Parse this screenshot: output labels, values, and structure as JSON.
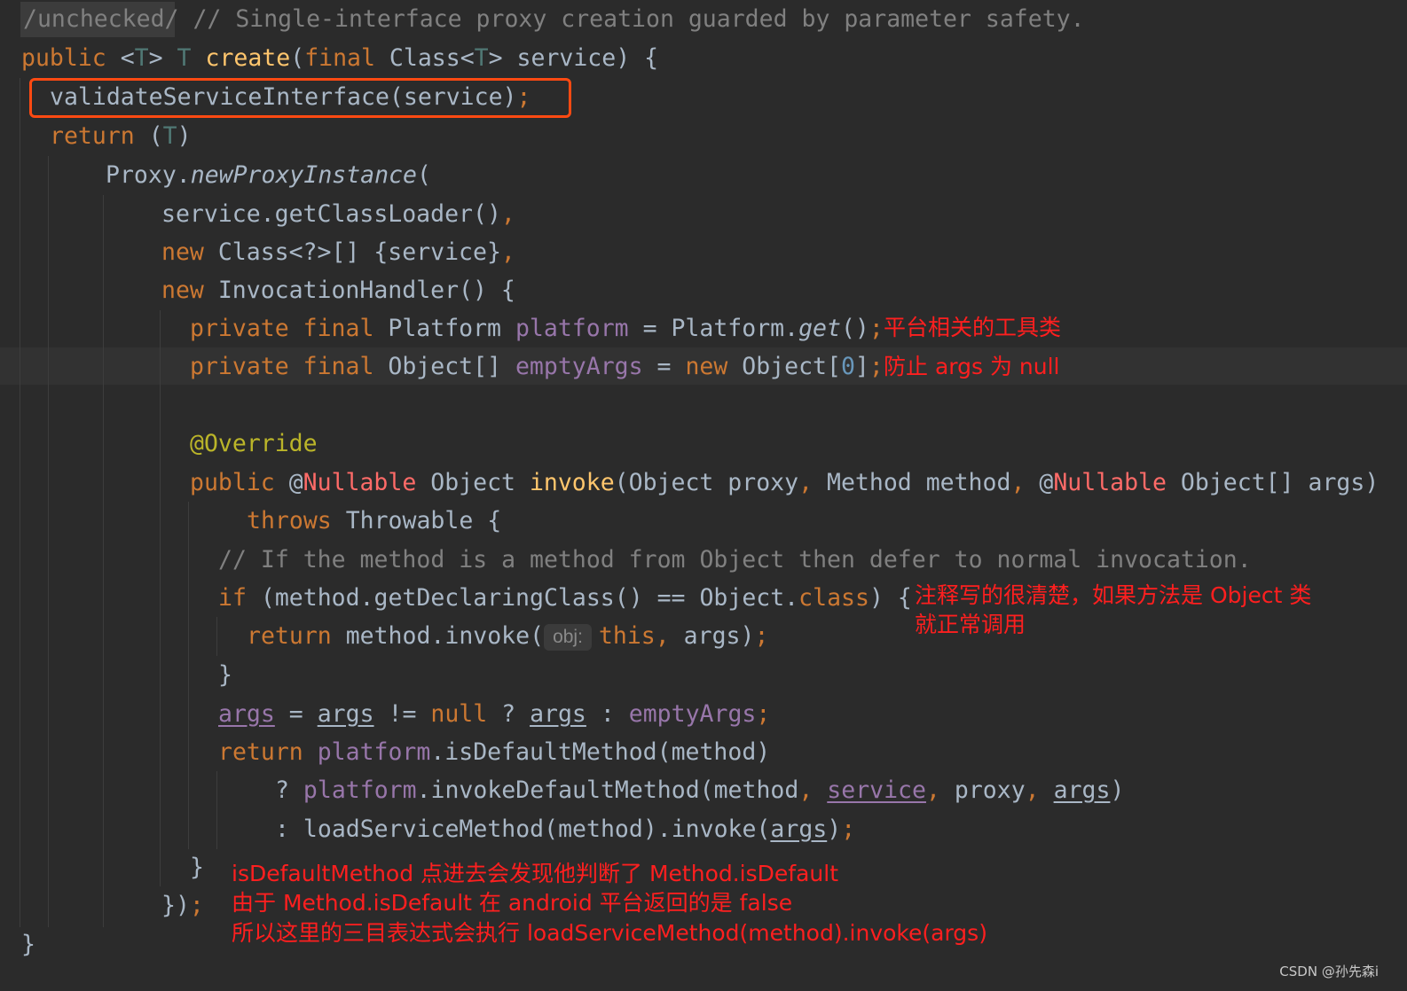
{
  "code": {
    "l1": {
      "a": "/unchecked/",
      "b": " // Single-interface proxy creation guarded by parameter safety."
    },
    "l2": {
      "a": "public",
      "b": " <",
      "c": "T",
      "d": "> ",
      "e": "T",
      "f": " ",
      "g": "create",
      "h": "(",
      "i": "final",
      "j": " Class<",
      "k": "T",
      "l": "> service) {"
    },
    "l3": {
      "a": "validateServiceInterface(service)",
      "b": ";"
    },
    "l4": {
      "a": "return",
      "b": " (",
      "c": "T",
      "d": ")"
    },
    "l5": {
      "a": "Proxy.",
      "b": "newProxyInstance",
      "c": "("
    },
    "l6": {
      "a": "service.getClassLoader()",
      "b": ","
    },
    "l7": {
      "a": "new",
      "b": " Class<?>[] {service}",
      "c": ","
    },
    "l8": {
      "a": "new",
      "b": " InvocationHandler() {"
    },
    "l9": {
      "a": "private final",
      "b": " Platform ",
      "c": "platform",
      "d": " = Platform.",
      "e": "get",
      "f": "()",
      "g": ";"
    },
    "l10": {
      "a": "private final",
      "b": " Object[] ",
      "c": "emptyArgs",
      "d": " = ",
      "e": "new",
      "f": " Object[",
      "g": "0",
      "h": "]",
      "i": ";"
    },
    "l11": {
      "a": "@Override"
    },
    "l12": {
      "a": "public",
      "b": " @",
      "c": "Nullable",
      "d": " Object ",
      "e": "invoke",
      "f": "(Object proxy",
      "g": ",",
      "h": " Method method",
      "i": ",",
      "j": " @",
      "k": "Nullable",
      "l": " Object[] args)"
    },
    "l13": {
      "a": "throws",
      "b": " Throwable {"
    },
    "l14": {
      "a": "// If the method is a method from Object then defer to normal invocation."
    },
    "l15": {
      "a": "if",
      "b": " (method.getDeclaringClass() == Object.",
      "c": "class",
      "d": ") {"
    },
    "l16": {
      "a": "return",
      "b": " method.invoke(",
      "hint": "obj:",
      "c": "this",
      "d": ",",
      "e": " args)",
      "f": ";"
    },
    "l17": {
      "a": "}"
    },
    "l18": {
      "a": "args",
      "b": " = ",
      "c": "args",
      "d": " != ",
      "e": "null",
      "f": " ? ",
      "g": "args",
      "h": " : ",
      "i": "emptyArgs",
      "j": ";"
    },
    "l19": {
      "a": "return",
      "b": " ",
      "c": "platform",
      "d": ".isDefaultMethod(method)"
    },
    "l20": {
      "a": "? ",
      "b": "platform",
      "c": ".invokeDefaultMethod(method",
      "d": ",",
      "e": " ",
      "f": "service",
      "g": ",",
      "h": " proxy",
      "i": ",",
      "j": " ",
      "k": "args",
      "l": ")"
    },
    "l21": {
      "a": ": loadServiceMethod(method).invoke(",
      "b": "args",
      "c": ")",
      "d": ";"
    },
    "l22": {
      "a": "}"
    },
    "l23": {
      "a": "})",
      "b": ";"
    },
    "l24": {
      "a": "}"
    }
  },
  "notes": {
    "platform_note": "平台相关的工具类",
    "emptyargs_note": "防止 args 为 null",
    "object_note_1": "注释写的很清楚，如果方法是 Object 类",
    "object_note_2": "就正常调用",
    "default_note_1": "isDefaultMethod 点进去会发现他判断了 Method.isDefault",
    "default_note_2": "由于 Method.isDefault 在 android 平台返回的是 false",
    "default_note_3": "所以这里的三目表达式会执行 loadServiceMethod(method).invoke(args)"
  },
  "watermark": "CSDN @孙先森i",
  "colors": {
    "background": "#2b2b2b",
    "keyword": "#cc7832",
    "field": "#9876aa",
    "method": "#ffc66d",
    "comment": "#808080",
    "annotation_note": "#ff1f1f",
    "highlight_box": "#ff4a12"
  }
}
